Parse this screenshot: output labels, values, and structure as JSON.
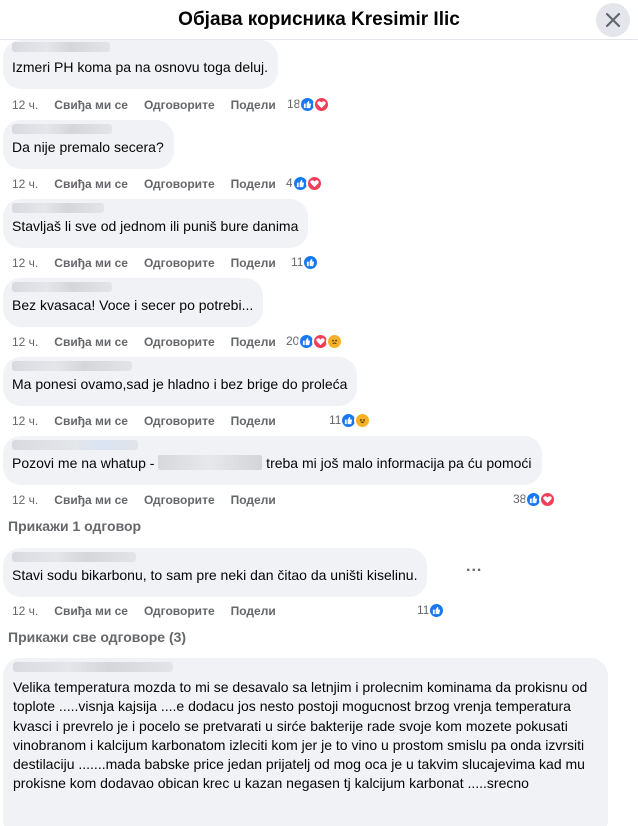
{
  "header": {
    "title": "Објава корисника Kresimir Ilic"
  },
  "actions_labels": {
    "like": "Свиђа ми се",
    "reply": "Одговорите",
    "share": "Подели"
  },
  "comments": [
    {
      "text": "Izmeri PH koma pa na osnovu toga deluj.",
      "time": "12 ч.",
      "count": "18",
      "reactions": [
        "like",
        "love"
      ]
    },
    {
      "text": "Da nije premalo secera?",
      "time": "12 ч.",
      "count": "4",
      "reactions": [
        "like",
        "love"
      ]
    },
    {
      "text": "Stavljaš li sve od jednom ili puniš bure danima",
      "time": "12 ч.",
      "count": "11",
      "reactions": [
        "like"
      ]
    },
    {
      "text": "Bez kvasaca! Voce i secer po potrebi...",
      "time": "12 ч.",
      "count": "20",
      "reactions": [
        "like",
        "love",
        "sad"
      ]
    },
    {
      "text": "Ma ponesi ovamo,sad je hladno i bez brige do proleća",
      "time": "12 ч.",
      "count": "11",
      "reactions": [
        "like",
        "haha"
      ]
    },
    {
      "text_before": "Pozovi me na whatup - ",
      "text_after": " treba mi još malo informacija pa ću pomoći",
      "time": "12 ч.",
      "count": "38",
      "reactions": [
        "like",
        "love"
      ]
    },
    {
      "text": "Stavi sodu bikarbonu, to sam pre neki dan čitao da uništi kiselinu.",
      "time": "12 ч.",
      "count": "11",
      "reactions": [
        "like"
      ]
    },
    {
      "text": "Velika temperatura mozda to mi se desavalo sa letnjim i prolecnim kominama da prokisnu od toplote .....visnja kajsija ....e dodacu jos nesto postoji mogucnost brzog vrenja temperatura kvasci i prevrelo je i pocelo se pretvarati u sirće bakterije rade svoje kom mozete pokusati vinobranom i kalcijum karbonatom izleciti kom jer je to vino u prostom smislu pa onda izvrsiti destilaciju .......mada babske price jedan prijatelj od mog oca je u takvim slucajevima kad mu prokisne kom dodavao obican krec u kazan negasen tj kalcijum karbonat .....srecno"
    }
  ],
  "show_replies": {
    "one": "Прикажи 1 одговор",
    "all": "Прикажи све одговоре (3)"
  },
  "more_options": "...",
  "colors": {
    "like": "#1877f2",
    "love": "#f33e58",
    "sad": "#f7b125",
    "bubble": "#f0f2f5",
    "muted": "#65676b"
  }
}
